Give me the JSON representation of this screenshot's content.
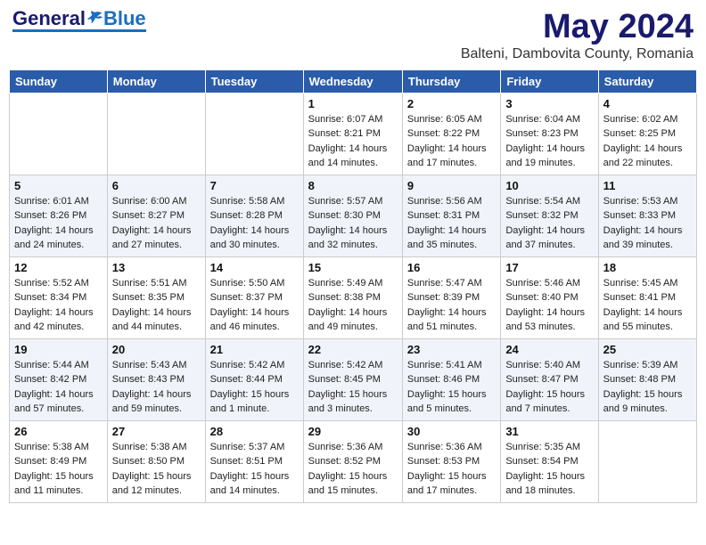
{
  "logo": {
    "general": "General",
    "blue": "Blue"
  },
  "header": {
    "month": "May 2024",
    "location": "Balteni, Dambovita County, Romania"
  },
  "weekdays": [
    "Sunday",
    "Monday",
    "Tuesday",
    "Wednesday",
    "Thursday",
    "Friday",
    "Saturday"
  ],
  "weeks": [
    [
      {
        "day": "",
        "info": ""
      },
      {
        "day": "",
        "info": ""
      },
      {
        "day": "",
        "info": ""
      },
      {
        "day": "1",
        "info": "Sunrise: 6:07 AM\nSunset: 8:21 PM\nDaylight: 14 hours\nand 14 minutes."
      },
      {
        "day": "2",
        "info": "Sunrise: 6:05 AM\nSunset: 8:22 PM\nDaylight: 14 hours\nand 17 minutes."
      },
      {
        "day": "3",
        "info": "Sunrise: 6:04 AM\nSunset: 8:23 PM\nDaylight: 14 hours\nand 19 minutes."
      },
      {
        "day": "4",
        "info": "Sunrise: 6:02 AM\nSunset: 8:25 PM\nDaylight: 14 hours\nand 22 minutes."
      }
    ],
    [
      {
        "day": "5",
        "info": "Sunrise: 6:01 AM\nSunset: 8:26 PM\nDaylight: 14 hours\nand 24 minutes."
      },
      {
        "day": "6",
        "info": "Sunrise: 6:00 AM\nSunset: 8:27 PM\nDaylight: 14 hours\nand 27 minutes."
      },
      {
        "day": "7",
        "info": "Sunrise: 5:58 AM\nSunset: 8:28 PM\nDaylight: 14 hours\nand 30 minutes."
      },
      {
        "day": "8",
        "info": "Sunrise: 5:57 AM\nSunset: 8:30 PM\nDaylight: 14 hours\nand 32 minutes."
      },
      {
        "day": "9",
        "info": "Sunrise: 5:56 AM\nSunset: 8:31 PM\nDaylight: 14 hours\nand 35 minutes."
      },
      {
        "day": "10",
        "info": "Sunrise: 5:54 AM\nSunset: 8:32 PM\nDaylight: 14 hours\nand 37 minutes."
      },
      {
        "day": "11",
        "info": "Sunrise: 5:53 AM\nSunset: 8:33 PM\nDaylight: 14 hours\nand 39 minutes."
      }
    ],
    [
      {
        "day": "12",
        "info": "Sunrise: 5:52 AM\nSunset: 8:34 PM\nDaylight: 14 hours\nand 42 minutes."
      },
      {
        "day": "13",
        "info": "Sunrise: 5:51 AM\nSunset: 8:35 PM\nDaylight: 14 hours\nand 44 minutes."
      },
      {
        "day": "14",
        "info": "Sunrise: 5:50 AM\nSunset: 8:37 PM\nDaylight: 14 hours\nand 46 minutes."
      },
      {
        "day": "15",
        "info": "Sunrise: 5:49 AM\nSunset: 8:38 PM\nDaylight: 14 hours\nand 49 minutes."
      },
      {
        "day": "16",
        "info": "Sunrise: 5:47 AM\nSunset: 8:39 PM\nDaylight: 14 hours\nand 51 minutes."
      },
      {
        "day": "17",
        "info": "Sunrise: 5:46 AM\nSunset: 8:40 PM\nDaylight: 14 hours\nand 53 minutes."
      },
      {
        "day": "18",
        "info": "Sunrise: 5:45 AM\nSunset: 8:41 PM\nDaylight: 14 hours\nand 55 minutes."
      }
    ],
    [
      {
        "day": "19",
        "info": "Sunrise: 5:44 AM\nSunset: 8:42 PM\nDaylight: 14 hours\nand 57 minutes."
      },
      {
        "day": "20",
        "info": "Sunrise: 5:43 AM\nSunset: 8:43 PM\nDaylight: 14 hours\nand 59 minutes."
      },
      {
        "day": "21",
        "info": "Sunrise: 5:42 AM\nSunset: 8:44 PM\nDaylight: 15 hours\nand 1 minute."
      },
      {
        "day": "22",
        "info": "Sunrise: 5:42 AM\nSunset: 8:45 PM\nDaylight: 15 hours\nand 3 minutes."
      },
      {
        "day": "23",
        "info": "Sunrise: 5:41 AM\nSunset: 8:46 PM\nDaylight: 15 hours\nand 5 minutes."
      },
      {
        "day": "24",
        "info": "Sunrise: 5:40 AM\nSunset: 8:47 PM\nDaylight: 15 hours\nand 7 minutes."
      },
      {
        "day": "25",
        "info": "Sunrise: 5:39 AM\nSunset: 8:48 PM\nDaylight: 15 hours\nand 9 minutes."
      }
    ],
    [
      {
        "day": "26",
        "info": "Sunrise: 5:38 AM\nSunset: 8:49 PM\nDaylight: 15 hours\nand 11 minutes."
      },
      {
        "day": "27",
        "info": "Sunrise: 5:38 AM\nSunset: 8:50 PM\nDaylight: 15 hours\nand 12 minutes."
      },
      {
        "day": "28",
        "info": "Sunrise: 5:37 AM\nSunset: 8:51 PM\nDaylight: 15 hours\nand 14 minutes."
      },
      {
        "day": "29",
        "info": "Sunrise: 5:36 AM\nSunset: 8:52 PM\nDaylight: 15 hours\nand 15 minutes."
      },
      {
        "day": "30",
        "info": "Sunrise: 5:36 AM\nSunset: 8:53 PM\nDaylight: 15 hours\nand 17 minutes."
      },
      {
        "day": "31",
        "info": "Sunrise: 5:35 AM\nSunset: 8:54 PM\nDaylight: 15 hours\nand 18 minutes."
      },
      {
        "day": "",
        "info": ""
      }
    ]
  ]
}
